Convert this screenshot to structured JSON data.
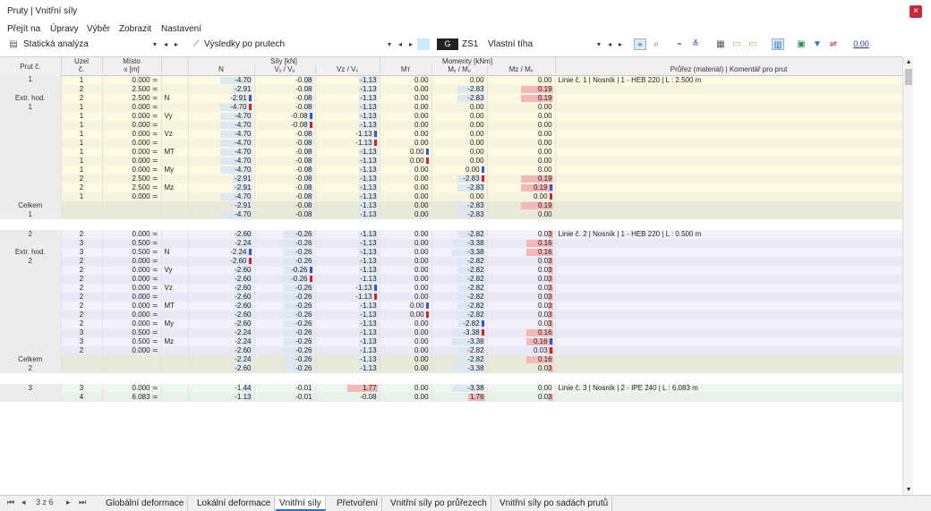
{
  "window": {
    "title": "Pruty | Vnitřní síly",
    "close_label": "×"
  },
  "menu": [
    "Přejít na",
    "Úpravy",
    "Výběr",
    "Zobrazit",
    "Nastavení"
  ],
  "toolbar": {
    "analysis": "Statická analýza",
    "results": "Výsledky po prutech",
    "load_badge": "G",
    "load_case": "ZS1",
    "load_name": "Vlastní tíha",
    "numeric_label": "0.00"
  },
  "header": {
    "prut": "Prut č.",
    "uzel1": "Uzel",
    "uzel2": "č.",
    "misto1": "Místo",
    "misto2": "x [m]",
    "sily": "Síly [kN]",
    "momenty": "Momenty [kNm]",
    "n": "N",
    "vy": "Vᵧ / Vᵤ",
    "vz": "Vz / Vᵥ",
    "mt": "Mт",
    "my": "Mᵧ / Mᵤ",
    "mz": "Mz / Mᵥ",
    "prurez": "Průřez (materiál) | Komentář pro prut"
  },
  "groups": [
    {
      "row_color": "#fdf9e3",
      "alt_color": "#f6f3df",
      "rows": [
        {
          "label": "1",
          "node": "1",
          "x": "0.000 ≍",
          "kind": "",
          "n": "-4.70",
          "vy": "-0.08",
          "vz": "-1.13",
          "mt": "0.00",
          "my": "0.00",
          "mz": "0.00",
          "comment": "Linie č. 1 | Nosník | 1 - HEB 220 | L : 2.500 m"
        },
        {
          "label": "",
          "node": "2",
          "x": "2.500 ≍",
          "kind": "",
          "n": "-2.91",
          "vy": "-0.08",
          "vz": "-1.13",
          "mt": "0.00",
          "my": "-2.83",
          "mz": "0.19",
          "comment": ""
        },
        {
          "label": "Extr. hod.",
          "node": "2",
          "x": "2.500 ≍",
          "kind": "N",
          "n": "-2.91",
          "vy": "-0.08",
          "vz": "-1.13",
          "mt": "0.00",
          "my": "-2.83",
          "mz": "0.19",
          "comment": "",
          "mk": {
            "n": "b"
          }
        },
        {
          "label": "1",
          "node": "1",
          "x": "0.000 ≍",
          "kind": "",
          "n": "-4.70",
          "vy": "-0.08",
          "vz": "-1.13",
          "mt": "0.00",
          "my": "0.00",
          "mz": "0.00",
          "comment": "",
          "mk": {
            "n": "r"
          }
        },
        {
          "label": "",
          "node": "1",
          "x": "0.000 ≍",
          "kind": "Vy",
          "n": "-4.70",
          "vy": "-0.08",
          "vz": "-1.13",
          "mt": "0.00",
          "my": "0.00",
          "mz": "0.00",
          "comment": "",
          "mk": {
            "vy": "b"
          }
        },
        {
          "label": "",
          "node": "1",
          "x": "0.000 ≍",
          "kind": "",
          "n": "-4.70",
          "vy": "-0.08",
          "vz": "-1.13",
          "mt": "0.00",
          "my": "0.00",
          "mz": "0.00",
          "comment": "",
          "mk": {
            "vy": "r"
          }
        },
        {
          "label": "",
          "node": "1",
          "x": "0.000 ≍",
          "kind": "Vz",
          "n": "-4.70",
          "vy": "-0.08",
          "vz": "-1.13",
          "mt": "0.00",
          "my": "0.00",
          "mz": "0.00",
          "comment": "",
          "mk": {
            "vz": "b"
          }
        },
        {
          "label": "",
          "node": "1",
          "x": "0.000 ≍",
          "kind": "",
          "n": "-4.70",
          "vy": "-0.08",
          "vz": "-1.13",
          "mt": "0.00",
          "my": "0.00",
          "mz": "0.00",
          "comment": "",
          "mk": {
            "vz": "r"
          }
        },
        {
          "label": "",
          "node": "1",
          "x": "0.000 ≍",
          "kind": "MT",
          "n": "-4.70",
          "vy": "-0.08",
          "vz": "-1.13",
          "mt": "0.00",
          "my": "0.00",
          "mz": "0.00",
          "comment": "",
          "mk": {
            "mt": "b"
          }
        },
        {
          "label": "",
          "node": "1",
          "x": "0.000 ≍",
          "kind": "",
          "n": "-4.70",
          "vy": "-0.08",
          "vz": "-1.13",
          "mt": "0.00",
          "my": "0.00",
          "mz": "0.00",
          "comment": "",
          "mk": {
            "mt": "r"
          }
        },
        {
          "label": "",
          "node": "1",
          "x": "0.000 ≍",
          "kind": "My",
          "n": "-4.70",
          "vy": "-0.08",
          "vz": "-1.13",
          "mt": "0.00",
          "my": "0.00",
          "mz": "0.00",
          "comment": "",
          "mk": {
            "my": "b"
          }
        },
        {
          "label": "",
          "node": "2",
          "x": "2.500 ≍",
          "kind": "",
          "n": "-2.91",
          "vy": "-0.08",
          "vz": "-1.13",
          "mt": "0.00",
          "my": "-2.83",
          "mz": "0.19",
          "comment": "",
          "mk": {
            "my": "r"
          }
        },
        {
          "label": "",
          "node": "2",
          "x": "2.500 ≍",
          "kind": "Mz",
          "n": "-2.91",
          "vy": "-0.08",
          "vz": "-1.13",
          "mt": "0.00",
          "my": "-2.83",
          "mz": "0.19",
          "comment": "",
          "mk": {
            "mz": "b"
          }
        },
        {
          "label": "",
          "node": "1",
          "x": "0.000 ≍",
          "kind": "",
          "n": "-4.70",
          "vy": "-0.08",
          "vz": "-1.13",
          "mt": "0.00",
          "my": "0.00",
          "mz": "0.00",
          "comment": "",
          "mk": {
            "mz": "r"
          }
        }
      ],
      "total": [
        {
          "label": "Celkem",
          "n": "-2.91",
          "vy": "-0.08",
          "vz": "-1.13",
          "mt": "0.00",
          "my": "-2.83",
          "mz": "0.19"
        },
        {
          "label": "1",
          "n": "-4.70",
          "vy": "-0.08",
          "vz": "-1.13",
          "mt": "0.00",
          "my": "-2.83",
          "mz": "0.00"
        }
      ]
    },
    {
      "row_color": "#f1f0fb",
      "alt_color": "#e9e8f6",
      "rows": [
        {
          "label": "2",
          "node": "2",
          "x": "0.000 ≍",
          "kind": "",
          "n": "-2.60",
          "vy": "-0.26",
          "vz": "-1.13",
          "mt": "0.00",
          "my": "-2.82",
          "mz": "0.03",
          "comment": "Linie č. 2 | Nosník | 1 - HEB 220 | L : 0.500 m"
        },
        {
          "label": "",
          "node": "3",
          "x": "0.500 ≍",
          "kind": "",
          "n": "-2.24",
          "vy": "-0.26",
          "vz": "-1.13",
          "mt": "0.00",
          "my": "-3.38",
          "mz": "0.16",
          "comment": ""
        },
        {
          "label": "Extr. hod.",
          "node": "3",
          "x": "0.500 ≍",
          "kind": "N",
          "n": "-2.24",
          "vy": "-0.26",
          "vz": "-1.13",
          "mt": "0.00",
          "my": "-3.38",
          "mz": "0.16",
          "comment": "",
          "mk": {
            "n": "b"
          }
        },
        {
          "label": "2",
          "node": "2",
          "x": "0.000 ≍",
          "kind": "",
          "n": "-2.60",
          "vy": "-0.26",
          "vz": "-1.13",
          "mt": "0.00",
          "my": "-2.82",
          "mz": "0.03",
          "comment": "",
          "mk": {
            "n": "r"
          }
        },
        {
          "label": "",
          "node": "2",
          "x": "0.000 ≍",
          "kind": "Vy",
          "n": "-2.60",
          "vy": "-0.26",
          "vz": "-1.13",
          "mt": "0.00",
          "my": "-2.82",
          "mz": "0.03",
          "comment": "",
          "mk": {
            "vy": "b"
          }
        },
        {
          "label": "",
          "node": "2",
          "x": "0.000 ≍",
          "kind": "",
          "n": "-2.60",
          "vy": "-0.26",
          "vz": "-1.13",
          "mt": "0.00",
          "my": "-2.82",
          "mz": "0.03",
          "comment": "",
          "mk": {
            "vy": "r"
          }
        },
        {
          "label": "",
          "node": "2",
          "x": "0.000 ≍",
          "kind": "Vz",
          "n": "-2.60",
          "vy": "-0.26",
          "vz": "-1.13",
          "mt": "0.00",
          "my": "-2.82",
          "mz": "0.03",
          "comment": "",
          "mk": {
            "vz": "b"
          }
        },
        {
          "label": "",
          "node": "2",
          "x": "0.000 ≍",
          "kind": "",
          "n": "-2.60",
          "vy": "-0.26",
          "vz": "-1.13",
          "mt": "0.00",
          "my": "-2.82",
          "mz": "0.03",
          "comment": "",
          "mk": {
            "vz": "r"
          }
        },
        {
          "label": "",
          "node": "2",
          "x": "0.000 ≍",
          "kind": "MT",
          "n": "-2.60",
          "vy": "-0.26",
          "vz": "-1.13",
          "mt": "0.00",
          "my": "-2.82",
          "mz": "0.03",
          "comment": "",
          "mk": {
            "mt": "b"
          }
        },
        {
          "label": "",
          "node": "2",
          "x": "0.000 ≍",
          "kind": "",
          "n": "-2.60",
          "vy": "-0.26",
          "vz": "-1.13",
          "mt": "0.00",
          "my": "-2.82",
          "mz": "0.03",
          "comment": "",
          "mk": {
            "mt": "r"
          }
        },
        {
          "label": "",
          "node": "2",
          "x": "0.000 ≍",
          "kind": "My",
          "n": "-2.60",
          "vy": "-0.26",
          "vz": "-1.13",
          "mt": "0.00",
          "my": "-2.82",
          "mz": "0.03",
          "comment": "",
          "mk": {
            "my": "b"
          }
        },
        {
          "label": "",
          "node": "3",
          "x": "0.500 ≍",
          "kind": "",
          "n": "-2.24",
          "vy": "-0.26",
          "vz": "-1.13",
          "mt": "0.00",
          "my": "-3.38",
          "mz": "0.16",
          "comment": "",
          "mk": {
            "my": "r"
          }
        },
        {
          "label": "",
          "node": "3",
          "x": "0.500 ≍",
          "kind": "Mz",
          "n": "-2.24",
          "vy": "-0.26",
          "vz": "-1.13",
          "mt": "0.00",
          "my": "-3.38",
          "mz": "0.16",
          "comment": "",
          "mk": {
            "mz": "b"
          }
        },
        {
          "label": "",
          "node": "2",
          "x": "0.000 ≍",
          "kind": "",
          "n": "-2.60",
          "vy": "-0.26",
          "vz": "-1.13",
          "mt": "0.00",
          "my": "-2.82",
          "mz": "0.03",
          "comment": "",
          "mk": {
            "mz": "r"
          }
        }
      ],
      "total": [
        {
          "label": "Celkem",
          "n": "-2.24",
          "vy": "-0.26",
          "vz": "-1.13",
          "mt": "0.00",
          "my": "-2.82",
          "mz": "0.16"
        },
        {
          "label": "2",
          "n": "-2.60",
          "vy": "-0.26",
          "vz": "-1.13",
          "mt": "0.00",
          "my": "-3.38",
          "mz": "0.03"
        }
      ]
    },
    {
      "row_color": "#eef6ef",
      "alt_color": "#e6f1e8",
      "rows": [
        {
          "label": "3",
          "node": "3",
          "x": "0.000 ≍",
          "kind": "",
          "n": "-1.44",
          "vy": "-0.01",
          "vz": "1.77",
          "mt": "0.00",
          "my": "-3.38",
          "mz": "0.00",
          "comment": "Linie č. 3 | Nosník | 2 - IPE 240 | L : 6.083 m"
        },
        {
          "label": "",
          "node": "4",
          "x": "6.083 ≍",
          "kind": "",
          "n": "-1.13",
          "vy": "-0.01",
          "vz": "-0.08",
          "mt": "0.00",
          "my": "1.76",
          "mz": "0.03",
          "comment": ""
        }
      ],
      "total": []
    }
  ],
  "tabs": {
    "pager": "3 z 6",
    "items": [
      "Globální deformace",
      "Lokální deformace",
      "Vnitřní síly",
      "Přetvoření",
      "Vnitřní síly po průřezech",
      "Vnitřní síly po sadách prutů"
    ],
    "active": 2
  }
}
